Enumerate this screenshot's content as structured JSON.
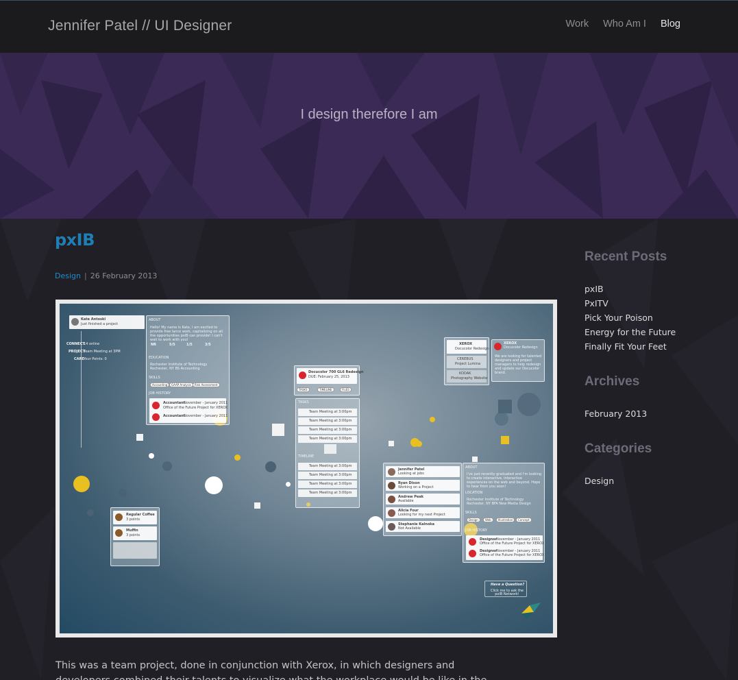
{
  "header": {
    "name": "Jennifer Patel",
    "separator": "//",
    "role": "UI Designer",
    "nav": [
      {
        "label": "Work",
        "active": false
      },
      {
        "label": "Who Am I",
        "active": false
      },
      {
        "label": "Blog",
        "active": true
      }
    ]
  },
  "hero": {
    "tagline": "I design therefore I am"
  },
  "post": {
    "title": "pxIB",
    "category": "Design",
    "meta_separator": "|",
    "date": "26 February 2013",
    "body": "This was a team project, done in conjunction with Xerox, in which designers and developers combined their talents to visualize what the workplace would be like in the"
  },
  "screenshot": {
    "profile_name": "Kate Antoski",
    "profile_role": "Accountant",
    "profile_status": "Just finished a project",
    "connect_label": "CONNECT",
    "connect_value": "14 online",
    "project_label": "PROJECT",
    "project_value": "Team Meeting at 3PM",
    "care_label": "CARE",
    "care_value": "Your Points: 0",
    "about_label": "ABOUT",
    "about_text": "Hello! My name is Kate, I am excited to provide free lance work, capitalizing on all the opportunities pxIB can provide! I can't wait to work with you!",
    "stats": [
      "NR",
      "5/5",
      "1/5",
      "3/5"
    ],
    "education_label": "EDUCATION",
    "education_text": "Rochester Institute of Technology Rochester, NY BS Accounting",
    "skills_label": "SKILLS",
    "skills": [
      "Accounting",
      "GAAP Analysis",
      "Risk Assessment"
    ],
    "history_label": "JOB HISTORY",
    "history_items": [
      {
        "title": "Accountant",
        "date": "November - January 2011",
        "sub": "Office of the Future Project for XEROX"
      },
      {
        "title": "Accountant",
        "date": "November - January 2011",
        "sub": ""
      }
    ],
    "project_title": "Docucolor 700 GL6 Redesign",
    "project_due": "DUE: February 25, 2013",
    "team_meeting": "Team Meeting at 3:00pm",
    "project_tabs": [
      "TASKS",
      "TIMELINE",
      "FILES"
    ],
    "tasks_label": "TASKS",
    "task_items": [
      "Team Meeting at 3:00pm",
      "Team Meeting at 3:00pm",
      "Team Meeting at 3:00pm",
      "Team Meeting at 3:00pm"
    ],
    "timeline_label": "TIMELINE",
    "timeline_items": [
      "Team Meeting at 3:00pm",
      "Team Meeting at 3:00pm",
      "Team Meeting at 3:00pm",
      "Team Meeting at 3:00pm"
    ],
    "xerox_title": "XEROX",
    "xerox_sub": "Docucolor Redesign",
    "cerebus": "CEREBUS",
    "cerebus_sub": "Project Lumina",
    "kodak": "KODAK",
    "kodak_sub": "Photography Website",
    "xerox_card_title": "XEROX",
    "xerox_card_sub": "Docucolor Redesign",
    "xerox_card_text": "We are looking for talented designers and project managers to help redesign and update our Docucolor brand.",
    "people": [
      {
        "name": "Jennifer Patel",
        "role": "Web Designer",
        "status": "Looking at jobs"
      },
      {
        "name": "Ryan Dixon",
        "role": "Graphic Designer",
        "status": "Working on a Project"
      },
      {
        "name": "Andrew Peak",
        "role": "Project Manager",
        "status": "Available"
      },
      {
        "name": "Alicia Four",
        "role": "New Media Designer",
        "status": "Looking for my next Project"
      },
      {
        "name": "Stephanie Kalnoka",
        "role": "Developer",
        "status": "Not Available"
      }
    ],
    "about2_label": "ABOUT",
    "about2_text": "I've just recently graduated and I'm looking to create interactive, interactive experiences on the web and beyond. Hope to hear from you soon!",
    "location_label": "LOCATION",
    "location_text": "Rochester Institute of Technology Rochester, NY BFA New Media Design",
    "skills2_label": "SKILLS",
    "skills2": [
      "Design",
      "Web",
      "Illustration",
      "Concept"
    ],
    "history2_label": "JOB HISTORY",
    "history2_items": [
      {
        "title": "Designer",
        "date": "November - January 2011",
        "sub": "Office of the Future Project for XEROX"
      },
      {
        "title": "Designer",
        "date": "November - January 2011",
        "sub": "Office of the Future Project for XEROX"
      }
    ],
    "cafe_items": [
      {
        "name": "Regular Coffee",
        "points": "3 points"
      },
      {
        "name": "Muffin",
        "points": "3 points"
      }
    ],
    "question_title": "Have a Question?",
    "question_text": "Click me to ask the pxIB Network!"
  },
  "sidebar": {
    "recent_title": "Recent Posts",
    "recent": [
      "pxIB",
      "PxITV",
      "Pick Your Poison",
      "Energy for the Future",
      "Finally Fit Your Feet"
    ],
    "archives_title": "Archives",
    "archives": [
      "February 2013"
    ],
    "categories_title": "Categories",
    "categories": [
      "Design"
    ]
  },
  "colors": {
    "header_bg": "#1b1b1d",
    "hero_bg": "#3a2a55",
    "content_bg": "#211f26",
    "accent_link": "#1f7fb5",
    "sidebar_heading": "#6e6a78"
  }
}
